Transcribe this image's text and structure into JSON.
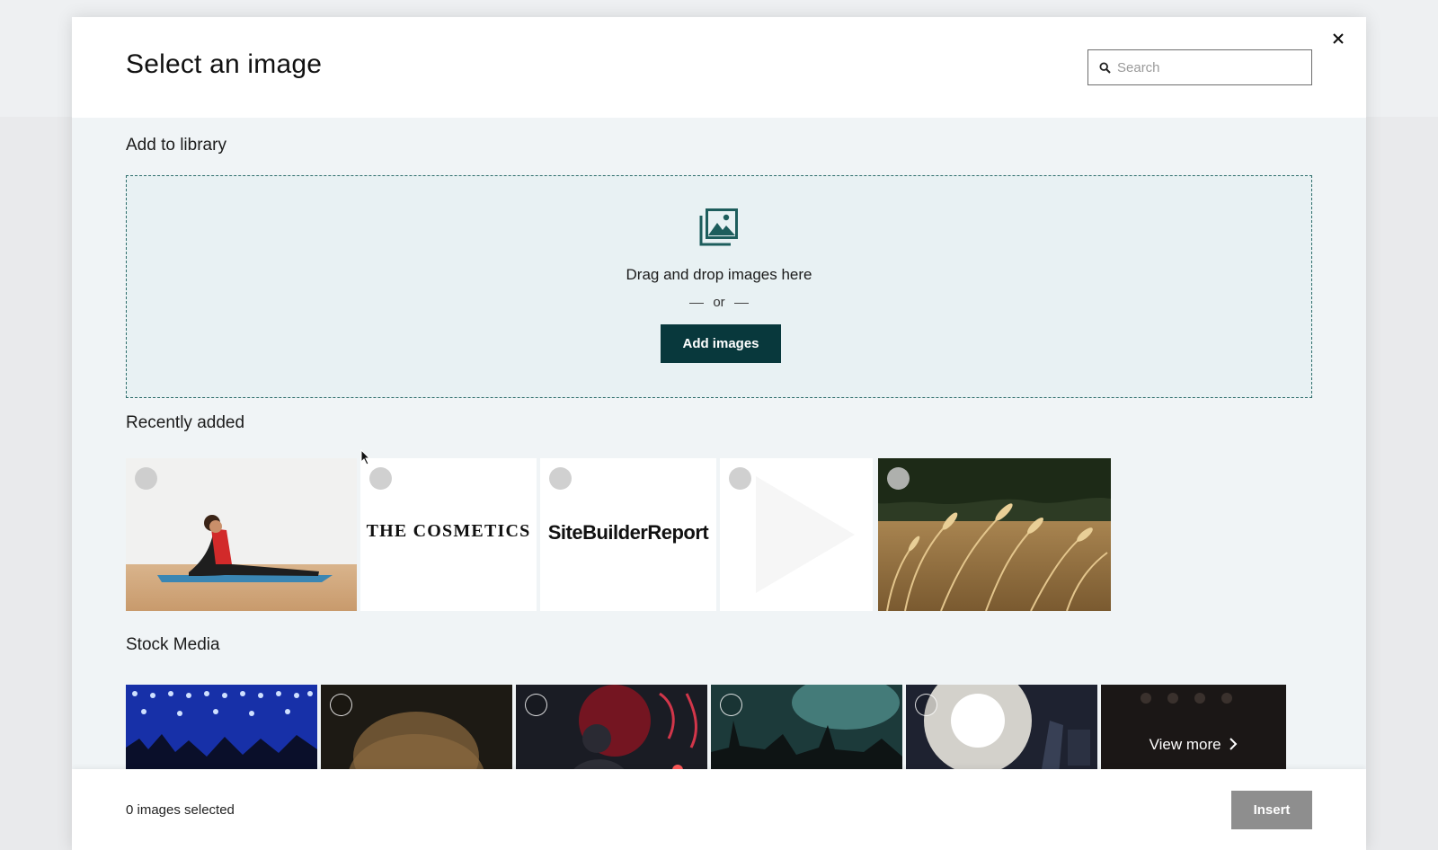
{
  "modal": {
    "title": "Select an image",
    "search_placeholder": "Search",
    "search_value": ""
  },
  "library": {
    "title": "Add to library",
    "drop_text": "Drag and drop images here",
    "or_text": "or",
    "add_button": "Add images"
  },
  "recent": {
    "title": "Recently added",
    "items": [
      {
        "kind": "photo",
        "subject": "woman doing yoga on mat"
      },
      {
        "kind": "logo",
        "text": "THE COSMETICS"
      },
      {
        "kind": "logo",
        "text": "SiteBuilderReport"
      },
      {
        "kind": "blank"
      },
      {
        "kind": "photo",
        "subject": "wheat field"
      }
    ]
  },
  "stock": {
    "title": "Stock Media",
    "items": [
      {
        "subject": "concert crowd with blue lights"
      },
      {
        "subject": "dark stage arch"
      },
      {
        "subject": "singer with red neon"
      },
      {
        "subject": "crowd with raised hands"
      },
      {
        "subject": "stage spotlight"
      },
      {
        "subject": "drum kit stage"
      }
    ],
    "view_more": "View more"
  },
  "footer": {
    "selected_text": "0 images selected",
    "insert_button": "Insert"
  },
  "colors": {
    "primary": "#08383c",
    "dropzone_border": "#2e6e6c",
    "insert_disabled": "#8e8e8e"
  }
}
